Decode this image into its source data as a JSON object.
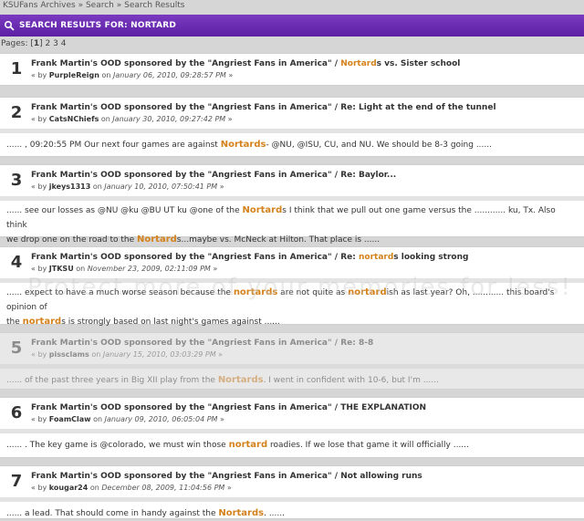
{
  "breadcrumb": [
    "KSUFans Archives",
    "Search",
    "Search Results"
  ],
  "breadcrumb_sep": "»",
  "banner": {
    "title": "SEARCH RESULTS FOR: NORTARD"
  },
  "pages": {
    "label": "Pages:",
    "current": "1",
    "others": [
      "2",
      "3",
      "4"
    ]
  },
  "results": [
    {
      "num": "1",
      "title_pre": "Frank Martin's OOD sponsored by the \"Angriest Fans in America\" / ",
      "title_hl": "Nortard",
      "title_post": "s vs. Sister school",
      "by": "« by",
      "user": "PurpleReign",
      "on": "on",
      "date": "January 06, 2010, 09:28:57 PM",
      "end": "»",
      "snippet_lines": []
    },
    {
      "num": "2",
      "title_pre": "Frank Martin's OOD sponsored by the \"Angriest Fans in America\" / Re: Light at the end of the tunnel",
      "title_hl": "",
      "title_post": "",
      "by": "« by",
      "user": "CatsNChiefs",
      "on": "on",
      "date": "January 30, 2010, 09:27:42 PM",
      "end": "»",
      "snippet_lines": [
        [
          {
            "t": "...... , 09:20:55 PM  Our next four games are against "
          },
          {
            "h": "Nortards"
          },
          {
            "t": "- @NU, @ISU, CU, and NU. We should be 8-3 going  ......"
          }
        ]
      ]
    },
    {
      "num": "3",
      "title_pre": "Frank Martin's OOD sponsored by the \"Angriest Fans in America\" / Re: Baylor...",
      "title_hl": "",
      "title_post": "",
      "by": "« by",
      "user": "jkeys1313",
      "on": "on",
      "date": "January 10, 2010, 07:50:41 PM",
      "end": "»",
      "snippet_lines": [
        [
          {
            "t": "......  see our losses as  @NU @ku @BU UT ku @one of the "
          },
          {
            "h": "Nortard"
          },
          {
            "t": "s     I think that we pull out one game versus the  ............  ku, Tx. Also think"
          }
        ],
        [
          {
            "t": "we drop one on the road to the "
          },
          {
            "h": "Nortard"
          },
          {
            "t": "s...maybe vs. McNeck at Hilton. That place is  ......"
          }
        ]
      ]
    },
    {
      "num": "4",
      "title_pre": "Frank Martin's OOD sponsored by the \"Angriest Fans in America\" / Re: ",
      "title_hl": "nortard",
      "title_post": "s looking strong",
      "by": "« by",
      "user": "JTKSU",
      "on": "on",
      "date": "November 23, 2009, 02:11:09 PM",
      "end": "»",
      "snippet_lines": [
        [
          {
            "t": "......  expect to have a much worse season because the "
          },
          {
            "h": "nortards"
          },
          {
            "t": " are not quite as "
          },
          {
            "h": "nortard"
          },
          {
            "t": "ish as last year? Oh,  ............  this board's opinion of"
          }
        ],
        [
          {
            "t": "the "
          },
          {
            "h": "nortard"
          },
          {
            "t": "s is strongly based on last night's games against  ......"
          }
        ]
      ]
    },
    {
      "num": "5",
      "title_pre": "Frank Martin's OOD sponsored by the \"Angriest Fans in America\" / Re: 8-8",
      "title_hl": "",
      "title_post": "",
      "by": "« by",
      "user": "pissclams",
      "on": "on",
      "date": "January 15, 2010, 03:03:29 PM",
      "end": "»",
      "snippet_lines": [
        [
          {
            "t": "......  of the past three years in Big XII play from the "
          },
          {
            "h": "Nortards"
          },
          {
            "t": ".  I went in confident with 10-6, but I'm  ......"
          }
        ]
      ]
    },
    {
      "num": "6",
      "title_pre": "Frank Martin's OOD sponsored by the \"Angriest Fans in America\" / THE EXPLANATION",
      "title_hl": "",
      "title_post": "",
      "by": "« by",
      "user": "FoamClaw",
      "on": "on",
      "date": "January 09, 2010, 06:05:04 PM",
      "end": "»",
      "snippet_lines": [
        [
          {
            "t": "...... . The key game is @colorado, we must win those "
          },
          {
            "h": "nortard"
          },
          {
            "t": " roadies. If we lose that game it will officially  ......"
          }
        ]
      ]
    },
    {
      "num": "7",
      "title_pre": "Frank Martin's OOD sponsored by the \"Angriest Fans in America\" / Not allowing runs",
      "title_hl": "",
      "title_post": "",
      "by": "« by",
      "user": "kougar24",
      "on": "on",
      "date": "December 08, 2009, 11:04:56 PM",
      "end": "»",
      "snippet_lines": [
        [
          {
            "t": "...... a lead. That should come in handy against the "
          },
          {
            "h": "Nortards"
          },
          {
            "t": ". ......"
          }
        ]
      ]
    }
  ],
  "watermark": "Protect more of your memories for less!",
  "colors": {
    "banner": "#6a2db5",
    "highlight": "#d4821c",
    "background": "#d6d6d6"
  }
}
